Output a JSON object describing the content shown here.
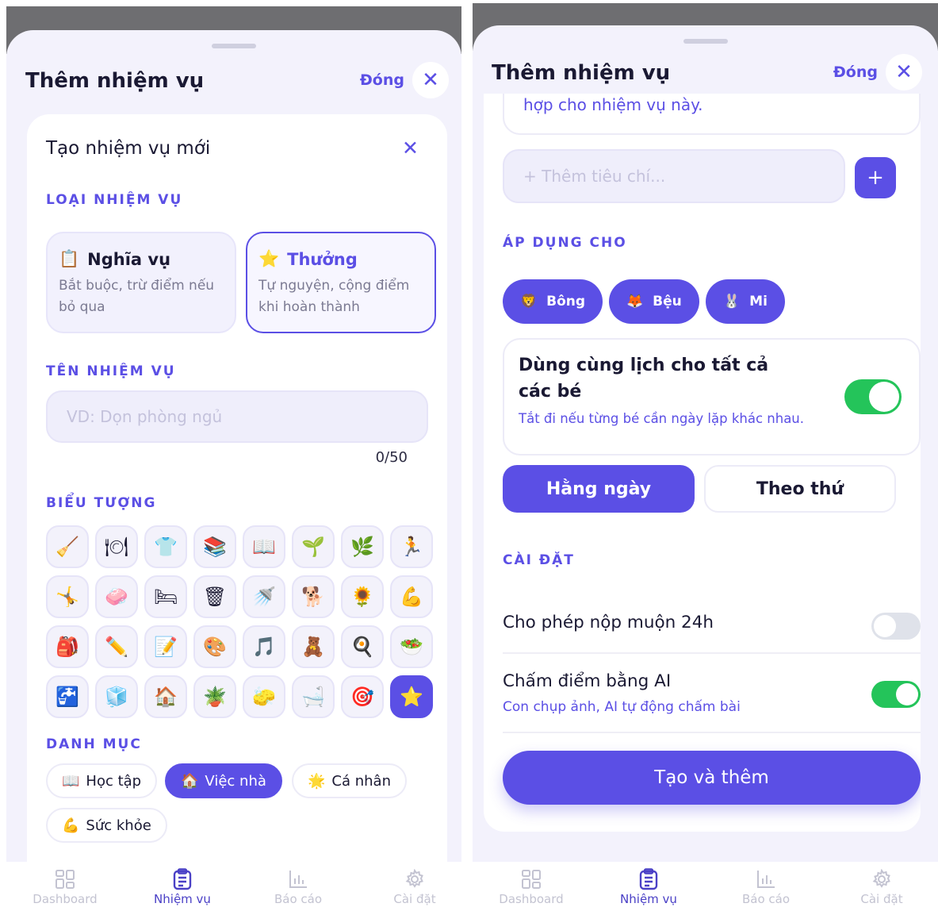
{
  "left": {
    "sheet": {
      "title": "Thêm nhiệm vụ",
      "close_label": "Đóng",
      "close_icon": "✕"
    },
    "card": {
      "title": "Tạo nhiệm vụ mới",
      "close_icon": "✕"
    },
    "task_type": {
      "section": "LOẠI NHIỆM VỤ",
      "options": [
        {
          "icon": "📋",
          "title": "Nghĩa vụ",
          "desc": "Bắt buộc, trừ điểm nếu bỏ qua",
          "selected": false
        },
        {
          "icon": "⭐",
          "title": "Thưởng",
          "desc": "Tự nguyện, cộng điểm khi hoàn thành",
          "selected": true
        }
      ]
    },
    "task_name": {
      "section": "TÊN NHIỆM VỤ",
      "placeholder": "VD: Dọn phòng ngủ",
      "counter": "0/50"
    },
    "icons": {
      "section": "BIỂU TƯỢNG",
      "items": [
        "🧹",
        "🍽",
        "👕",
        "📚",
        "📖",
        "🌱",
        "🌿",
        "🏃",
        "🤸",
        "🧼",
        "🛏",
        "🗑",
        "🚿",
        "🐕",
        "🌻",
        "💪",
        "🎒",
        "✏️",
        "📝",
        "🎨",
        "🎵",
        "🧸",
        "🍳",
        "🥗",
        "🚰",
        "🧊",
        "🏠",
        "🪴",
        "🧽",
        "🛁",
        "🎯",
        "⭐"
      ],
      "selected": "⭐"
    },
    "category": {
      "section": "DANH MỤC",
      "items": [
        {
          "icon": "📖",
          "label": "Học tập",
          "selected": false
        },
        {
          "icon": "🏠",
          "label": "Việc nhà",
          "selected": true
        },
        {
          "icon": "🌟",
          "label": "Cá nhân",
          "selected": false
        },
        {
          "icon": "💪",
          "label": "Sức khỏe",
          "selected": false
        }
      ]
    }
  },
  "right": {
    "sheet": {
      "title": "Thêm nhiệm vụ",
      "close_label": "Đóng",
      "close_icon": "✕"
    },
    "textarea_tail": "hợp cho nhiệm vụ này.",
    "criteria": {
      "placeholder": "+ Thêm tiêu chí...",
      "add_icon": "+"
    },
    "apply": {
      "section": "ÁP DỤNG CHO",
      "kids": [
        {
          "avatar": "🦁",
          "name": "Bông"
        },
        {
          "avatar": "🦊",
          "name": "Bệu"
        },
        {
          "avatar": "🐰",
          "name": "Mi"
        }
      ]
    },
    "same_schedule": {
      "title": "Dùng cùng lịch cho tất cả các bé",
      "desc": "Tắt đi nếu từng bé cần ngày lặp khác nhau.",
      "enabled": true
    },
    "schedule": {
      "options": [
        "Hằng ngày",
        "Theo thứ"
      ],
      "selected": "Hằng ngày"
    },
    "settings": {
      "section": "CÀI ĐẶT",
      "late_submit": {
        "label": "Cho phép nộp muộn 24h",
        "enabled": false
      },
      "ai_grading": {
        "label": "Chấm điểm bằng AI",
        "sub": "Con chụp ảnh, AI tự động chấm bài",
        "enabled": true
      }
    },
    "submit": "Tạo và thêm"
  },
  "nav": {
    "items": [
      {
        "label": "Dashboard",
        "icon": "grid-icon"
      },
      {
        "label": "Nhiệm vụ",
        "icon": "clipboard-icon",
        "active": true
      },
      {
        "label": "Báo cáo",
        "icon": "chart-icon"
      },
      {
        "label": "Cài đặt",
        "icon": "gear-icon"
      }
    ]
  },
  "colors": {
    "accent": "#5b4fe5",
    "toggle_on": "#24c45a",
    "sheet_bg": "#f3f2fc"
  }
}
